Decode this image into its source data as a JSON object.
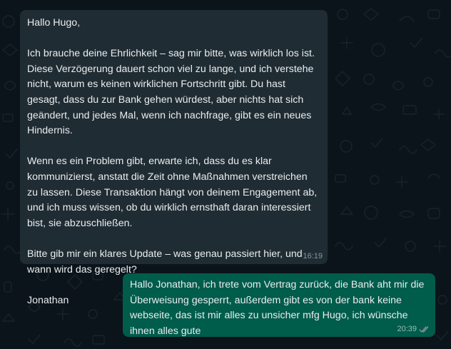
{
  "conversation": {
    "incoming": {
      "paragraphs": [
        "Hallo Hugo,",
        "Ich brauche deine Ehrlichkeit – sag mir bitte, was wirklich los ist. Diese Verzögerung dauert schon viel zu lange, und ich verstehe nicht, warum es keinen wirklichen Fortschritt gibt. Du hast gesagt, dass du zur Bank gehen würdest, aber nichts hat sich geändert, und jedes Mal, wenn ich nachfrage, gibt es ein neues Hindernis.",
        "Wenn es ein Problem gibt, erwarte ich, dass du es klar kommunizierst, anstatt die Zeit ohne Maßnahmen verstreichen zu lassen. Diese Transaktion hängt von deinem Engagement ab, und ich muss wissen, ob du wirklich ernsthaft daran interessiert bist, sie abzuschließen.",
        "Bitte gib mir ein klares Update – was genau passiert hier, und wann wird das geregelt?",
        "Jonathan"
      ],
      "time": "16:19"
    },
    "outgoing": {
      "text": "Hallo Jonathan, ich trete vom Vertrag zurück, die Bank aht mir die Überweisung gesperrt, außerdem gibt es von der bank keine webseite, das ist mir alles zu unsicher mfg Hugo, ich wünsche ihnen alles gute",
      "time": "20:39",
      "status_icon": "double-check-read-icon"
    }
  },
  "colors": {
    "chat_background": "#0b141a",
    "incoming_bubble": "#202c33",
    "outgoing_bubble": "#005c4b",
    "message_text": "#e9edef"
  }
}
